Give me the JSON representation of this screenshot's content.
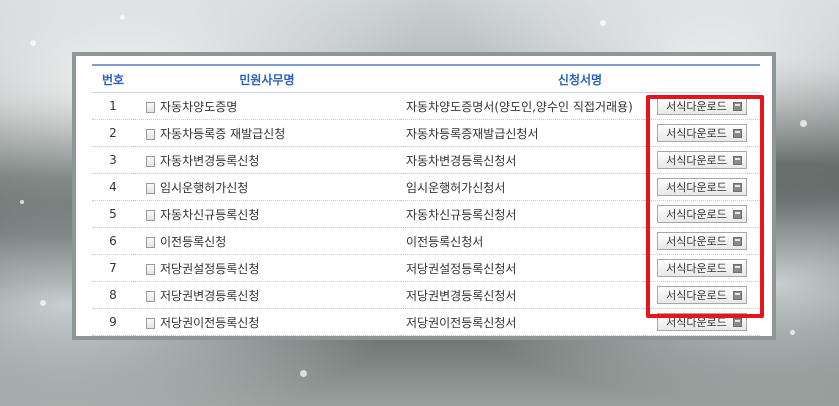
{
  "table": {
    "headers": {
      "number": "번호",
      "service_name": "민원사무명",
      "form_name": "신청서명"
    },
    "download_label": "서식다운로드",
    "rows": [
      {
        "num": "1",
        "service": "자동차양도증명",
        "form": "자동차양도증명서(양도인,양수인 직접거래용)"
      },
      {
        "num": "2",
        "service": "자동차등록증 재발급신청",
        "form": "자동차등록증재발급신청서"
      },
      {
        "num": "3",
        "service": "자동차변경등록신청",
        "form": "자동차변경등록신청서"
      },
      {
        "num": "4",
        "service": "임시운행허가신청",
        "form": "임시운행허가신청서"
      },
      {
        "num": "5",
        "service": "자동차신규등록신청",
        "form": "자동차신규등록신청서"
      },
      {
        "num": "6",
        "service": "이전등록신청",
        "form": "이전등록신청서"
      },
      {
        "num": "7",
        "service": "저당권설정등록신청",
        "form": "저당권설정등록신청서"
      },
      {
        "num": "8",
        "service": "저당권변경등록신청",
        "form": "저당권변경등록신청서"
      },
      {
        "num": "9",
        "service": "저당권이전등록신청",
        "form": "저당권이전등록신청서"
      }
    ]
  },
  "colors": {
    "header_text": "#2d62b8",
    "highlight_box": "#e8141c"
  }
}
